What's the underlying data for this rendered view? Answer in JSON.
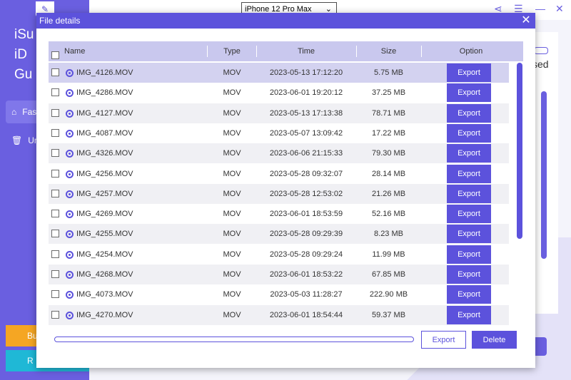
{
  "app": {
    "sidebar_title_lines": [
      "iSu",
      "iD",
      "Gu"
    ],
    "menu": [
      {
        "label": "Fas",
        "icon": "broom-icon"
      },
      {
        "label": "Un",
        "icon": "trash-icon"
      }
    ],
    "sidebar_buttons": [
      "Bu",
      "R"
    ],
    "device": "iPhone 12 Pro Max",
    "card_text": "sed"
  },
  "modal": {
    "title": "File details",
    "columns": {
      "name": "Name",
      "type": "Type",
      "time": "Time",
      "size": "Size",
      "option": "Option"
    },
    "export_label": "Export",
    "delete_label": "Delete",
    "rows": [
      {
        "name": "IMG_4126.MOV",
        "type": "MOV",
        "time": "2023-05-13 17:12:20",
        "size": "5.75 MB",
        "option": "Export"
      },
      {
        "name": "IMG_4286.MOV",
        "type": "MOV",
        "time": "2023-06-01 19:20:12",
        "size": "37.25 MB",
        "option": "Export"
      },
      {
        "name": "IMG_4127.MOV",
        "type": "MOV",
        "time": "2023-05-13 17:13:38",
        "size": "78.71 MB",
        "option": "Export"
      },
      {
        "name": "IMG_4087.MOV",
        "type": "MOV",
        "time": "2023-05-07 13:09:42",
        "size": "17.22 MB",
        "option": "Export"
      },
      {
        "name": "IMG_4326.MOV",
        "type": "MOV",
        "time": "2023-06-06 21:15:33",
        "size": "79.30 MB",
        "option": "Export"
      },
      {
        "name": "IMG_4256.MOV",
        "type": "MOV",
        "time": "2023-05-28 09:32:07",
        "size": "28.14 MB",
        "option": "Export"
      },
      {
        "name": "IMG_4257.MOV",
        "type": "MOV",
        "time": "2023-05-28 12:53:02",
        "size": "21.26 MB",
        "option": "Export"
      },
      {
        "name": "IMG_4269.MOV",
        "type": "MOV",
        "time": "2023-06-01 18:53:59",
        "size": "52.16 MB",
        "option": "Export"
      },
      {
        "name": "IMG_4255.MOV",
        "type": "MOV",
        "time": "2023-05-28 09:29:39",
        "size": "8.23 MB",
        "option": "Export"
      },
      {
        "name": "IMG_4254.MOV",
        "type": "MOV",
        "time": "2023-05-28 09:29:24",
        "size": "11.99 MB",
        "option": "Export"
      },
      {
        "name": "IMG_4268.MOV",
        "type": "MOV",
        "time": "2023-06-01 18:53:22",
        "size": "67.85 MB",
        "option": "Export"
      },
      {
        "name": "IMG_4073.MOV",
        "type": "MOV",
        "time": "2023-05-03 11:28:27",
        "size": "222.90 MB",
        "option": "Export"
      },
      {
        "name": "IMG_4270.MOV",
        "type": "MOV",
        "time": "2023-06-01 18:54:44",
        "size": "59.37 MB",
        "option": "Export"
      }
    ]
  },
  "colors": {
    "accent": "#5c52dc",
    "header_bg": "#c9c8ee",
    "sidebar": "#6a5fe0",
    "orange": "#f5a623",
    "teal": "#1fb8d6"
  }
}
